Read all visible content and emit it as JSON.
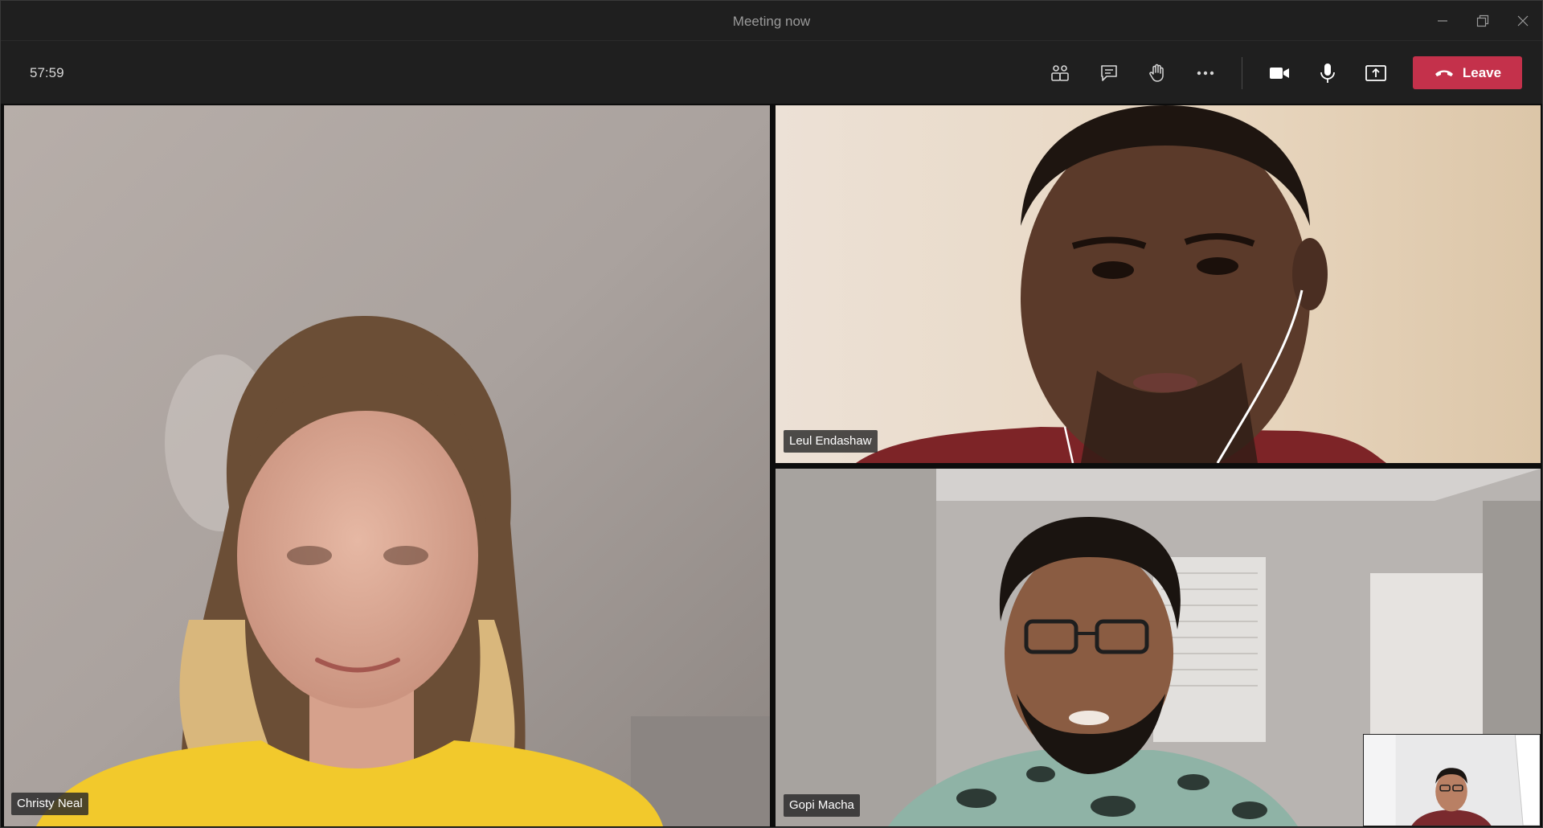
{
  "window": {
    "title": "Meeting now"
  },
  "toolbar": {
    "timer": "57:59",
    "buttons": [
      {
        "name": "participants",
        "icon": "people-icon"
      },
      {
        "name": "chat",
        "icon": "chat-icon"
      },
      {
        "name": "raise-hand",
        "icon": "hand-icon"
      },
      {
        "name": "more-actions",
        "icon": "more-icon"
      },
      {
        "name": "camera",
        "icon": "camera-icon"
      },
      {
        "name": "microphone",
        "icon": "microphone-icon"
      },
      {
        "name": "share",
        "icon": "share-tray-icon"
      }
    ],
    "leave_label": "Leave"
  },
  "participants": [
    {
      "name": "Christy Neal"
    },
    {
      "name": "Leul Endashaw"
    },
    {
      "name": "Gopi Macha"
    }
  ],
  "colors": {
    "leave_button": "#c4314b",
    "toolbar_bg": "#1f1f1f",
    "icon": "#d6d6d6"
  }
}
